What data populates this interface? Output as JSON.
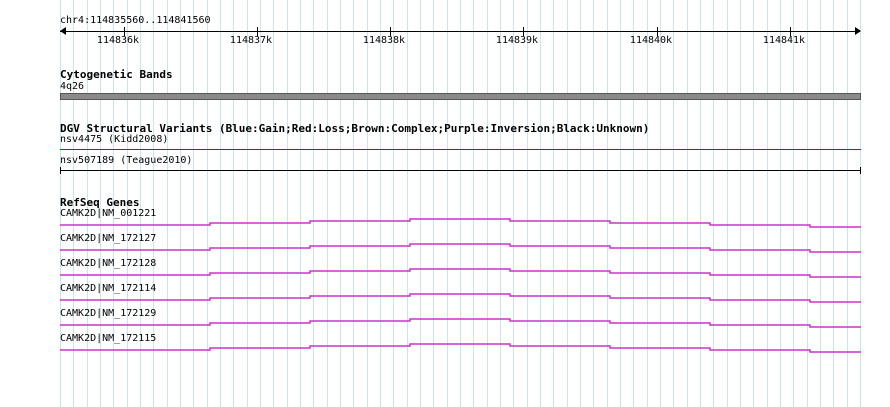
{
  "location": "chr4:114835560..114841560",
  "ruler": {
    "ticks": [
      "114836k",
      "114837k",
      "114838k",
      "114839k",
      "114840k",
      "114841k"
    ]
  },
  "tracks": {
    "cytoband": {
      "title": "Cytogenetic Bands",
      "band_label": "4q26",
      "band_color": "#8a8a8a"
    },
    "dgv": {
      "title": "DGV Structural Variants (Blue:Gain;Red:Loss;Brown:Complex;Purple:Inversion;Black:Unknown)",
      "features": [
        {
          "label": "nsv4475 (Kidd2008)",
          "color": "#cc0000"
        },
        {
          "label": "nsv507189 (Teague2010)",
          "color": "#000000"
        }
      ]
    },
    "refseq": {
      "title": "RefSeq Genes",
      "color": "#cc33cc",
      "genes": [
        {
          "label": "CAMK2D|NM_001221"
        },
        {
          "label": "CAMK2D|NM_172127"
        },
        {
          "label": "CAMK2D|NM_172128"
        },
        {
          "label": "CAMK2D|NM_172114"
        },
        {
          "label": "CAMK2D|NM_172129"
        },
        {
          "label": "CAMK2D|NM_172115"
        }
      ]
    }
  }
}
